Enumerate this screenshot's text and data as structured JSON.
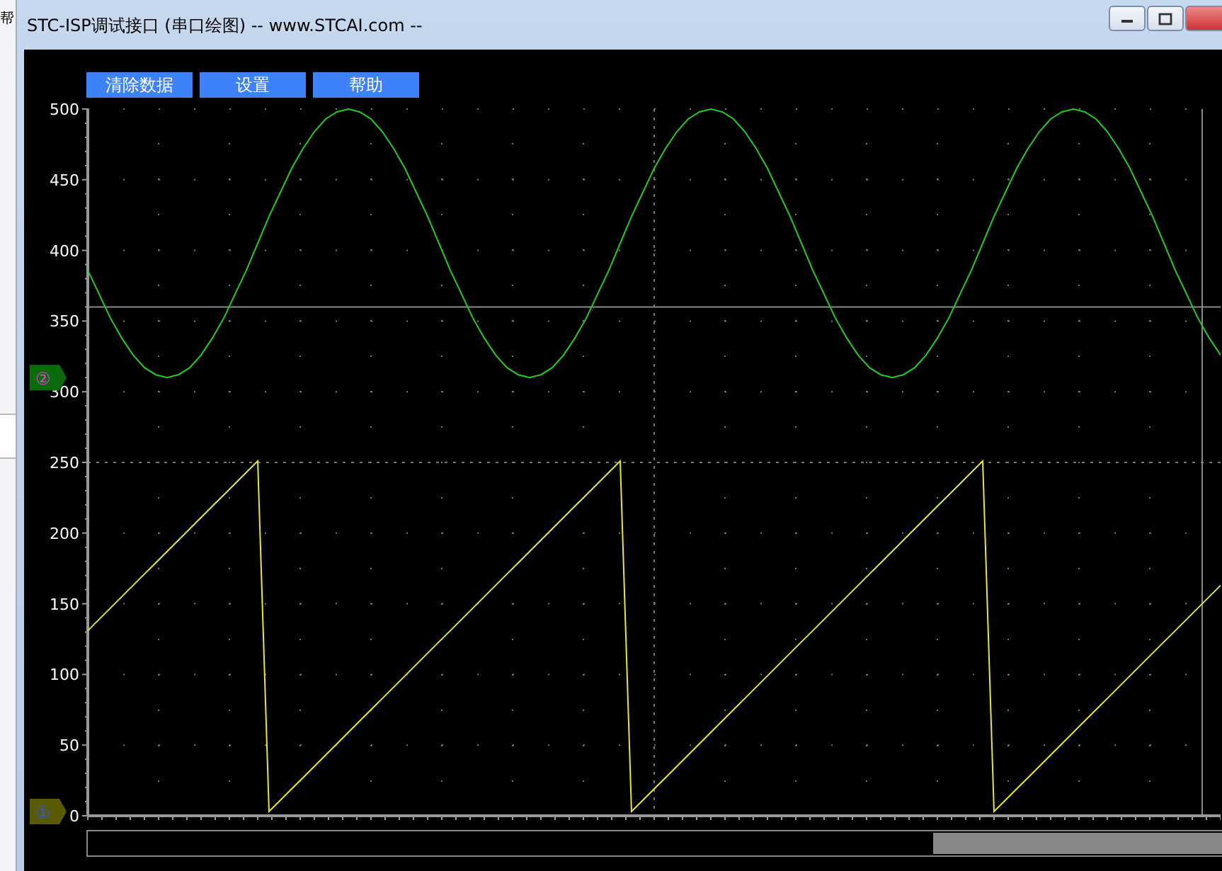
{
  "background_window": {
    "text": "帮"
  },
  "window": {
    "title": "STC-ISP调试接口 (串口绘图) -- www.STCAI.com --"
  },
  "toolbar": {
    "buttons": [
      "清除数据",
      "设置",
      "帮助"
    ]
  },
  "plot": {
    "chart_data": {
      "type": "line",
      "grid": true,
      "ref_lines": [
        {
          "axis": "y",
          "value": 360
        }
      ],
      "ylim": [
        0,
        500
      ],
      "yticks": [
        0,
        50,
        100,
        150,
        200,
        250,
        300,
        350,
        400,
        450,
        500
      ],
      "categories": [
        null,
        null,
        null,
        null,
        null,
        null,
        null,
        null,
        null,
        null,
        null,
        null,
        null,
        null,
        null,
        null,
        null,
        null,
        null,
        null,
        null,
        null,
        null,
        null,
        null,
        null,
        null,
        null,
        null,
        null,
        null,
        null,
        null,
        null,
        null,
        null,
        null,
        null,
        null,
        null,
        null,
        null,
        null,
        null,
        null,
        null,
        null,
        null,
        null,
        null,
        null,
        null,
        null,
        null,
        null,
        null,
        null,
        null,
        null,
        null,
        null,
        null,
        null,
        null,
        null,
        null,
        null,
        null,
        null,
        null,
        null,
        null,
        null,
        null,
        null,
        null,
        null,
        null,
        null,
        null,
        null,
        null,
        null,
        null,
        null,
        null,
        null,
        null,
        null,
        null,
        null,
        null,
        null,
        null,
        null,
        null,
        null,
        null,
        null,
        null,
        null
      ],
      "series": [
        {
          "color": "#22cc22",
          "values": [
            386,
            369,
            352,
            338,
            326,
            317,
            312,
            310,
            312,
            317,
            326,
            338,
            352,
            369,
            386,
            405,
            424,
            441,
            458,
            472,
            484,
            493,
            498,
            500,
            498,
            493,
            484,
            472,
            458,
            441,
            424,
            405,
            386,
            369,
            352,
            338,
            326,
            317,
            312,
            310,
            312,
            317,
            326,
            338,
            352,
            369,
            386,
            405,
            424,
            441,
            458,
            472,
            484,
            493,
            498,
            500,
            498,
            493,
            484,
            472,
            458,
            441,
            424,
            405,
            386,
            369,
            352,
            338,
            326,
            317,
            312,
            310,
            312,
            317,
            326,
            338,
            352,
            369,
            386,
            405,
            424,
            441,
            458,
            472,
            484,
            493,
            498,
            500,
            498,
            493,
            484,
            472,
            458,
            441,
            424,
            405,
            386,
            369,
            352,
            338,
            326
          ]
        },
        {
          "color": "#e8e830",
          "values": [
            131,
            139,
            147,
            155,
            163,
            171,
            179,
            187,
            195,
            203,
            211,
            219,
            227,
            235,
            243,
            251,
            3,
            11,
            19,
            27,
            35,
            43,
            51,
            59,
            67,
            75,
            83,
            91,
            99,
            107,
            115,
            123,
            131,
            139,
            147,
            155,
            163,
            171,
            179,
            187,
            195,
            203,
            211,
            219,
            227,
            235,
            243,
            251,
            3,
            11,
            19,
            27,
            35,
            43,
            51,
            59,
            67,
            75,
            83,
            91,
            99,
            107,
            115,
            123,
            131,
            139,
            147,
            155,
            163,
            171,
            179,
            187,
            195,
            203,
            211,
            219,
            227,
            235,
            243,
            251,
            3,
            11,
            19,
            27,
            35,
            43,
            51,
            59,
            67,
            75,
            83,
            91,
            99,
            107,
            115,
            123,
            131,
            139,
            147,
            155,
            163
          ]
        }
      ]
    },
    "channel_markers": [
      {
        "label": "②",
        "color": "#0b6b0b"
      },
      {
        "label": "①",
        "color": "#5a5a00"
      }
    ]
  }
}
